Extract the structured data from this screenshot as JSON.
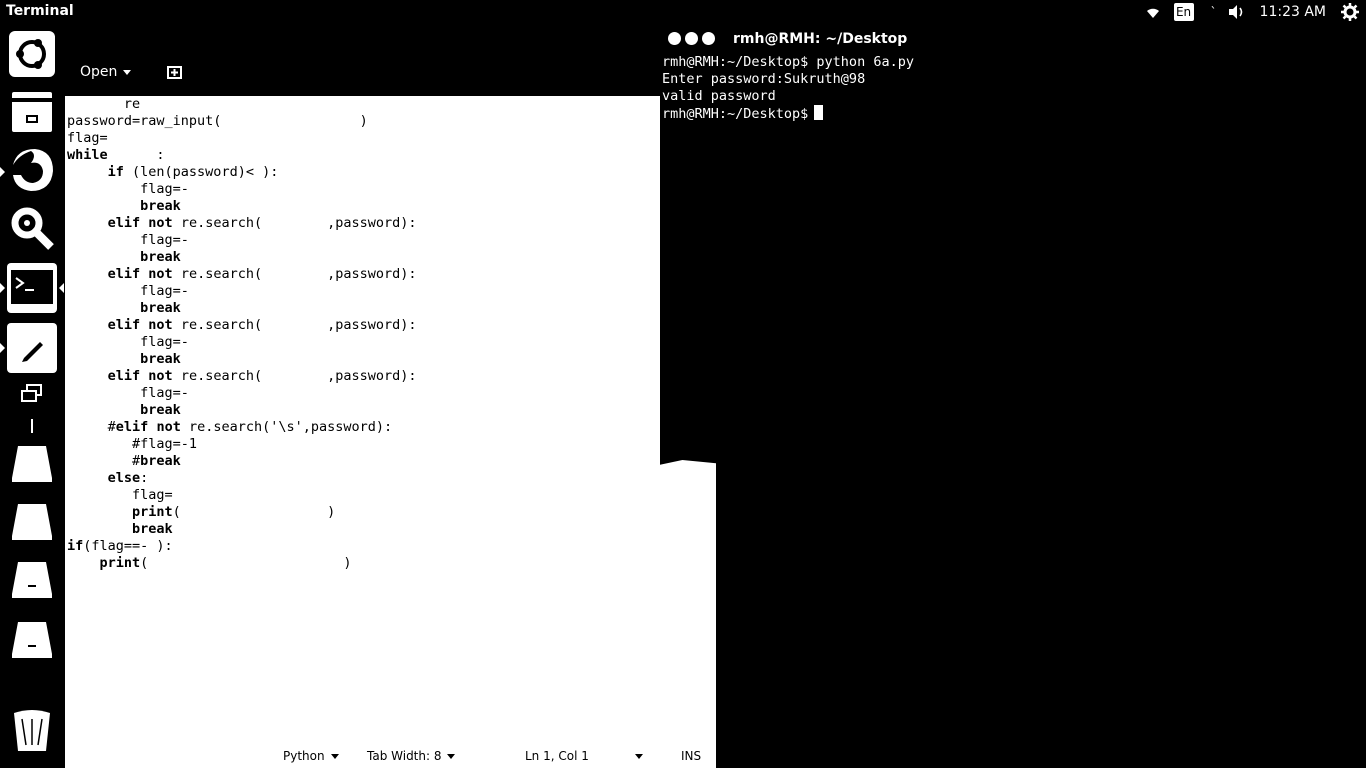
{
  "topbar": {
    "app_title": "Terminal",
    "lang": "En",
    "misc": "`",
    "clock": "11:23 AM",
    "icons": [
      "wifi-icon",
      "language-indicator",
      "volume-icon",
      "gear-icon"
    ]
  },
  "launcher": {
    "items": [
      "dash-icon",
      "files-icon",
      "firefox-icon",
      "settings-icon",
      "terminal-icon",
      "text-editor-icon",
      "workspace-icon",
      "drive-icon",
      "drive-icon",
      "drive-icon",
      "drive-icon",
      "drive-icon",
      "trash-icon"
    ]
  },
  "gedit": {
    "open_label": "Open",
    "code_lines": [
      "       re",
      "password=raw_input(                 )",
      "flag=",
      "while      :",
      "     if (len(password)< ):",
      "         flag=-",
      "         break",
      "     elif not re.search(        ,password):",
      "         flag=-",
      "         break",
      "     elif not re.search(        ,password):",
      "         flag=-",
      "         break",
      "     elif not re.search(        ,password):",
      "         flag=-",
      "         break",
      "     elif not re.search(        ,password):",
      "         flag=-",
      "         break",
      "     #elif not re.search('\\s',password):",
      "        #flag=-1",
      "        #break",
      "     else:",
      "        flag=",
      "        print(                  )",
      "        break",
      "if(flag==- ):",
      "    print(                        )"
    ],
    "status": {
      "language": "Python",
      "tab_width": "Tab Width: 8",
      "position": "Ln 1, Col 1",
      "mode": "INS"
    }
  },
  "terminal": {
    "title": "rmh@RMH: ~/Desktop",
    "lines": [
      "rmh@RMH:~/Desktop$ python 6a.py",
      "Enter password:Sukruth@98",
      "valid password",
      "rmh@RMH:~/Desktop$"
    ]
  }
}
